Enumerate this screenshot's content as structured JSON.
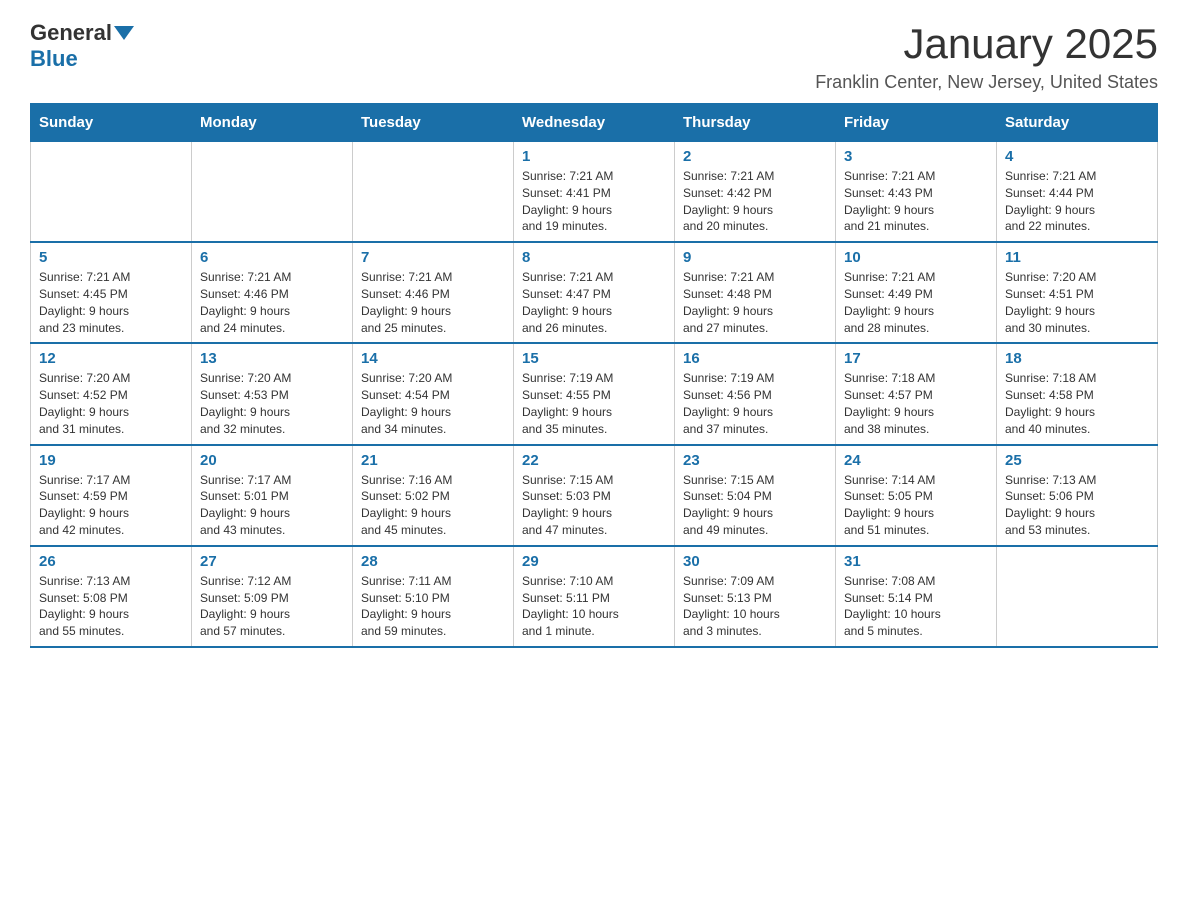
{
  "logo": {
    "general": "General",
    "blue": "Blue"
  },
  "title": "January 2025",
  "location": "Franklin Center, New Jersey, United States",
  "days_of_week": [
    "Sunday",
    "Monday",
    "Tuesday",
    "Wednesday",
    "Thursday",
    "Friday",
    "Saturday"
  ],
  "weeks": [
    [
      {
        "day": "",
        "info": ""
      },
      {
        "day": "",
        "info": ""
      },
      {
        "day": "",
        "info": ""
      },
      {
        "day": "1",
        "info": "Sunrise: 7:21 AM\nSunset: 4:41 PM\nDaylight: 9 hours\nand 19 minutes."
      },
      {
        "day": "2",
        "info": "Sunrise: 7:21 AM\nSunset: 4:42 PM\nDaylight: 9 hours\nand 20 minutes."
      },
      {
        "day": "3",
        "info": "Sunrise: 7:21 AM\nSunset: 4:43 PM\nDaylight: 9 hours\nand 21 minutes."
      },
      {
        "day": "4",
        "info": "Sunrise: 7:21 AM\nSunset: 4:44 PM\nDaylight: 9 hours\nand 22 minutes."
      }
    ],
    [
      {
        "day": "5",
        "info": "Sunrise: 7:21 AM\nSunset: 4:45 PM\nDaylight: 9 hours\nand 23 minutes."
      },
      {
        "day": "6",
        "info": "Sunrise: 7:21 AM\nSunset: 4:46 PM\nDaylight: 9 hours\nand 24 minutes."
      },
      {
        "day": "7",
        "info": "Sunrise: 7:21 AM\nSunset: 4:46 PM\nDaylight: 9 hours\nand 25 minutes."
      },
      {
        "day": "8",
        "info": "Sunrise: 7:21 AM\nSunset: 4:47 PM\nDaylight: 9 hours\nand 26 minutes."
      },
      {
        "day": "9",
        "info": "Sunrise: 7:21 AM\nSunset: 4:48 PM\nDaylight: 9 hours\nand 27 minutes."
      },
      {
        "day": "10",
        "info": "Sunrise: 7:21 AM\nSunset: 4:49 PM\nDaylight: 9 hours\nand 28 minutes."
      },
      {
        "day": "11",
        "info": "Sunrise: 7:20 AM\nSunset: 4:51 PM\nDaylight: 9 hours\nand 30 minutes."
      }
    ],
    [
      {
        "day": "12",
        "info": "Sunrise: 7:20 AM\nSunset: 4:52 PM\nDaylight: 9 hours\nand 31 minutes."
      },
      {
        "day": "13",
        "info": "Sunrise: 7:20 AM\nSunset: 4:53 PM\nDaylight: 9 hours\nand 32 minutes."
      },
      {
        "day": "14",
        "info": "Sunrise: 7:20 AM\nSunset: 4:54 PM\nDaylight: 9 hours\nand 34 minutes."
      },
      {
        "day": "15",
        "info": "Sunrise: 7:19 AM\nSunset: 4:55 PM\nDaylight: 9 hours\nand 35 minutes."
      },
      {
        "day": "16",
        "info": "Sunrise: 7:19 AM\nSunset: 4:56 PM\nDaylight: 9 hours\nand 37 minutes."
      },
      {
        "day": "17",
        "info": "Sunrise: 7:18 AM\nSunset: 4:57 PM\nDaylight: 9 hours\nand 38 minutes."
      },
      {
        "day": "18",
        "info": "Sunrise: 7:18 AM\nSunset: 4:58 PM\nDaylight: 9 hours\nand 40 minutes."
      }
    ],
    [
      {
        "day": "19",
        "info": "Sunrise: 7:17 AM\nSunset: 4:59 PM\nDaylight: 9 hours\nand 42 minutes."
      },
      {
        "day": "20",
        "info": "Sunrise: 7:17 AM\nSunset: 5:01 PM\nDaylight: 9 hours\nand 43 minutes."
      },
      {
        "day": "21",
        "info": "Sunrise: 7:16 AM\nSunset: 5:02 PM\nDaylight: 9 hours\nand 45 minutes."
      },
      {
        "day": "22",
        "info": "Sunrise: 7:15 AM\nSunset: 5:03 PM\nDaylight: 9 hours\nand 47 minutes."
      },
      {
        "day": "23",
        "info": "Sunrise: 7:15 AM\nSunset: 5:04 PM\nDaylight: 9 hours\nand 49 minutes."
      },
      {
        "day": "24",
        "info": "Sunrise: 7:14 AM\nSunset: 5:05 PM\nDaylight: 9 hours\nand 51 minutes."
      },
      {
        "day": "25",
        "info": "Sunrise: 7:13 AM\nSunset: 5:06 PM\nDaylight: 9 hours\nand 53 minutes."
      }
    ],
    [
      {
        "day": "26",
        "info": "Sunrise: 7:13 AM\nSunset: 5:08 PM\nDaylight: 9 hours\nand 55 minutes."
      },
      {
        "day": "27",
        "info": "Sunrise: 7:12 AM\nSunset: 5:09 PM\nDaylight: 9 hours\nand 57 minutes."
      },
      {
        "day": "28",
        "info": "Sunrise: 7:11 AM\nSunset: 5:10 PM\nDaylight: 9 hours\nand 59 minutes."
      },
      {
        "day": "29",
        "info": "Sunrise: 7:10 AM\nSunset: 5:11 PM\nDaylight: 10 hours\nand 1 minute."
      },
      {
        "day": "30",
        "info": "Sunrise: 7:09 AM\nSunset: 5:13 PM\nDaylight: 10 hours\nand 3 minutes."
      },
      {
        "day": "31",
        "info": "Sunrise: 7:08 AM\nSunset: 5:14 PM\nDaylight: 10 hours\nand 5 minutes."
      },
      {
        "day": "",
        "info": ""
      }
    ]
  ]
}
